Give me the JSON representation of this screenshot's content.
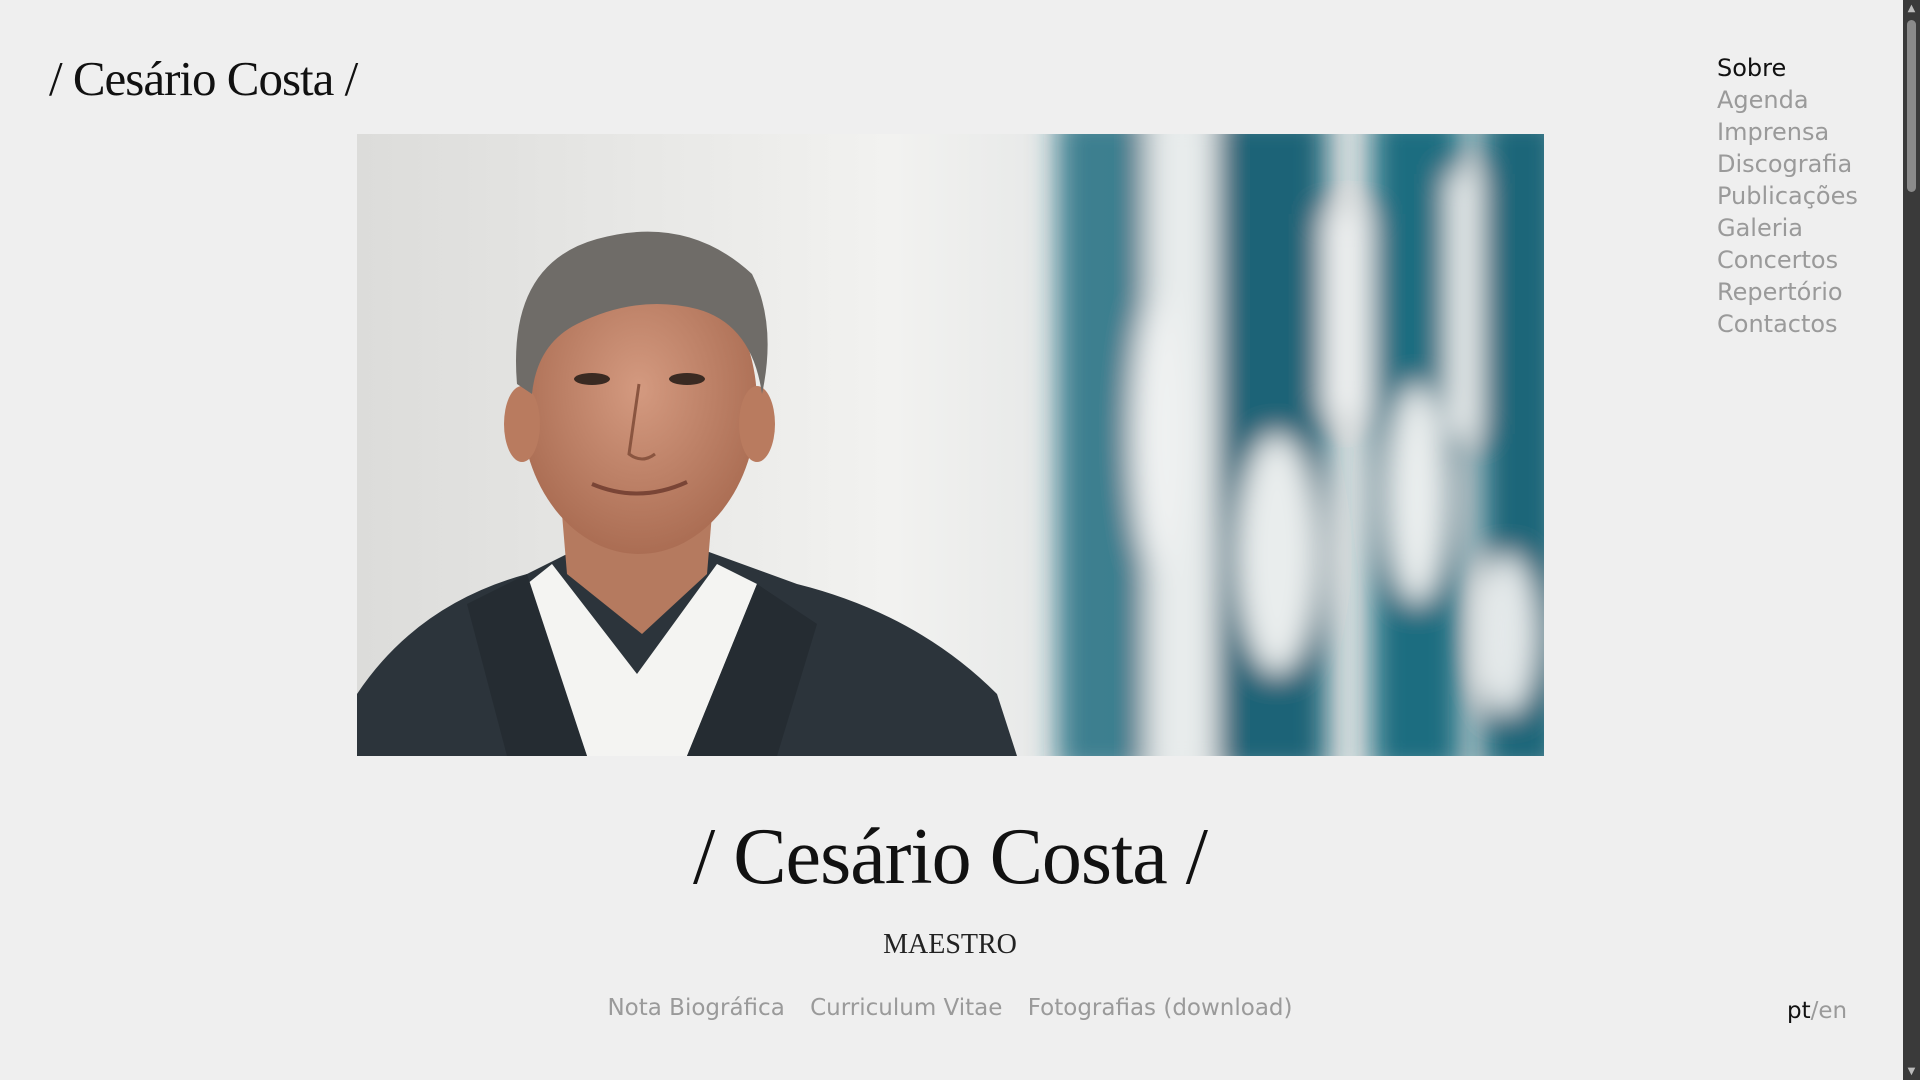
{
  "header": {
    "logo": "/ Cesário Costa /"
  },
  "nav": {
    "items": [
      {
        "label": "Sobre",
        "active": true
      },
      {
        "label": "Agenda",
        "active": false
      },
      {
        "label": "Imprensa",
        "active": false
      },
      {
        "label": "Discografia",
        "active": false
      },
      {
        "label": "Publicações",
        "active": false
      },
      {
        "label": "Galeria",
        "active": false
      },
      {
        "label": "Concertos",
        "active": false
      },
      {
        "label": "Repertório",
        "active": false
      },
      {
        "label": "Contactos",
        "active": false
      }
    ]
  },
  "main": {
    "title": "/ Cesário Costa /",
    "subtitle": "MAESTRO",
    "links": [
      "Nota Biográfica",
      "Curriculum Vitae",
      "Fotografias (download)"
    ]
  },
  "language": {
    "current": "pt",
    "separator": "/",
    "other": "en"
  },
  "colors": {
    "background": "#efefef",
    "text": "#111111",
    "muted": "#9a9a9a",
    "photo_blue": "#1f6d80"
  },
  "icons": {
    "scroll_up": "triangle-up-icon",
    "scroll_down": "triangle-down-icon"
  }
}
